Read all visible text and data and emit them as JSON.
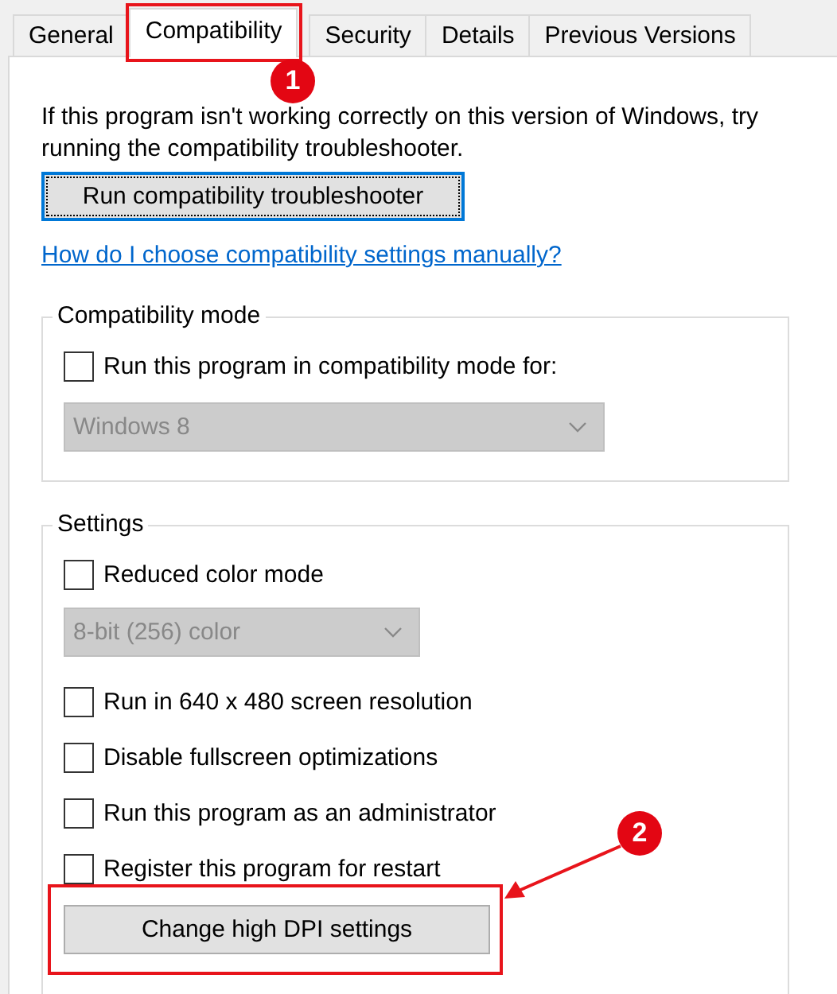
{
  "tabs": [
    {
      "label": "General",
      "selected": false
    },
    {
      "label": "Compatibility",
      "selected": true
    },
    {
      "label": "Security",
      "selected": false
    },
    {
      "label": "Details",
      "selected": false
    },
    {
      "label": "Previous Versions",
      "selected": false
    }
  ],
  "intro": "If this program isn't working correctly on this version of Windows, try running the compatibility troubleshooter.",
  "troubleshooter_button": {
    "label": "Run compatibility troubleshooter",
    "focused": true
  },
  "help_link": "How do I choose compatibility settings manually?",
  "groups": [
    {
      "title": "Compatibility mode",
      "items": [
        {
          "kind": "checkbox",
          "label": "Run this program in compatibility mode for:",
          "checked": false
        },
        {
          "kind": "dropdown",
          "value": "Windows 8",
          "disabled": true,
          "wide": true
        }
      ]
    },
    {
      "title": "Settings",
      "items": [
        {
          "kind": "checkbox",
          "label": "Reduced color mode",
          "checked": false
        },
        {
          "kind": "dropdown",
          "value": "8-bit (256) color",
          "disabled": true,
          "wide": false
        },
        {
          "kind": "checkbox",
          "label": "Run in 640 x 480 screen resolution",
          "checked": false
        },
        {
          "kind": "checkbox",
          "label": "Disable fullscreen optimizations",
          "checked": false
        },
        {
          "kind": "checkbox",
          "label": "Run this program as an administrator",
          "checked": false
        },
        {
          "kind": "checkbox",
          "label": "Register this program for restart",
          "checked": false
        },
        {
          "kind": "button",
          "label": "Change high DPI settings",
          "focused": false
        }
      ]
    }
  ],
  "annotations": [
    {
      "number": "1"
    },
    {
      "number": "2"
    }
  ]
}
